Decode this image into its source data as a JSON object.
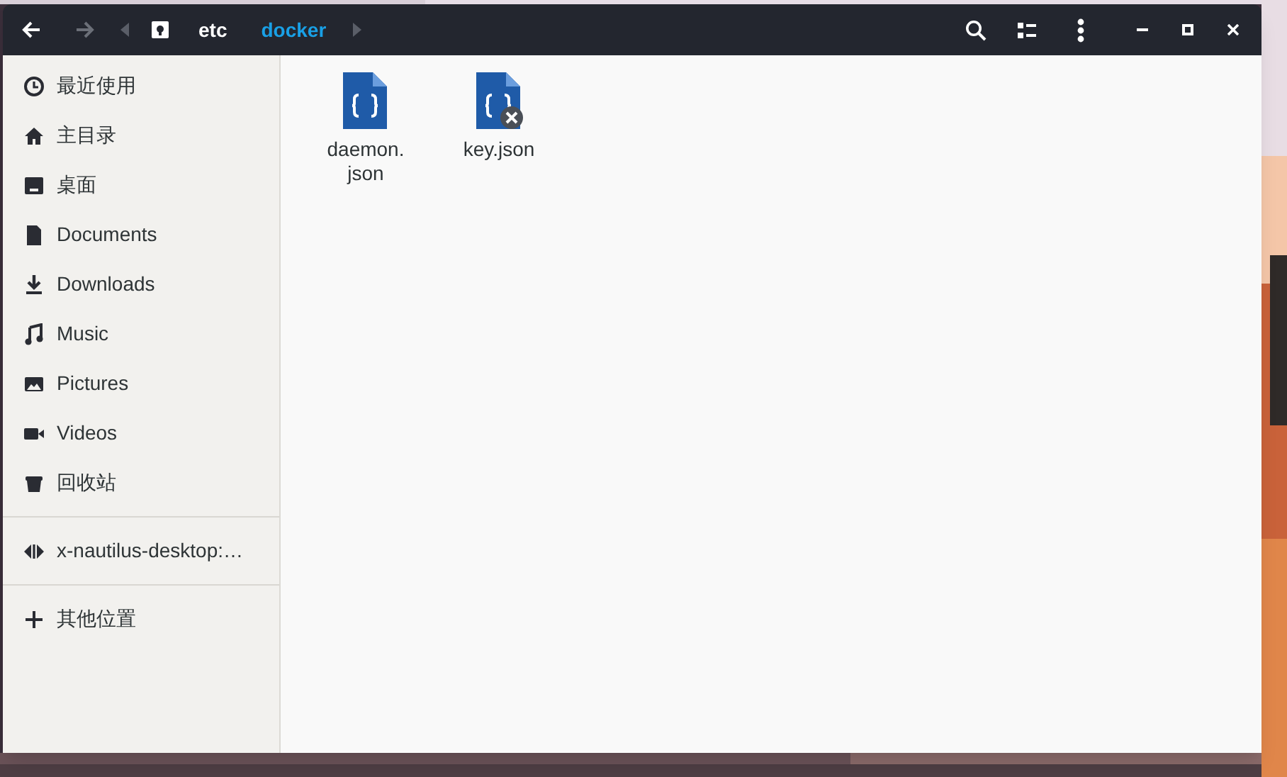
{
  "headerbar": {
    "back": {
      "disabled": false
    },
    "forward": {
      "disabled": true
    },
    "path": [
      {
        "label": "etc",
        "selected": false
      },
      {
        "label": "docker",
        "selected": true
      }
    ]
  },
  "sidebar": {
    "sections": [
      {
        "items": [
          {
            "label": "最近使用"
          },
          {
            "label": "主目录"
          },
          {
            "label": "桌面"
          },
          {
            "label": "Documents"
          },
          {
            "label": "Downloads"
          },
          {
            "label": "Music"
          },
          {
            "label": "Pictures"
          },
          {
            "label": "Videos"
          },
          {
            "label": "回收站"
          }
        ]
      },
      {
        "items": [
          {
            "label": "x-nautilus-desktop:…"
          }
        ]
      },
      {
        "items": [
          {
            "label": "其他位置"
          }
        ]
      }
    ]
  },
  "files": [
    {
      "name": "daemon.\njson",
      "unreadable": false
    },
    {
      "name": "key.json",
      "unreadable": true
    }
  ]
}
